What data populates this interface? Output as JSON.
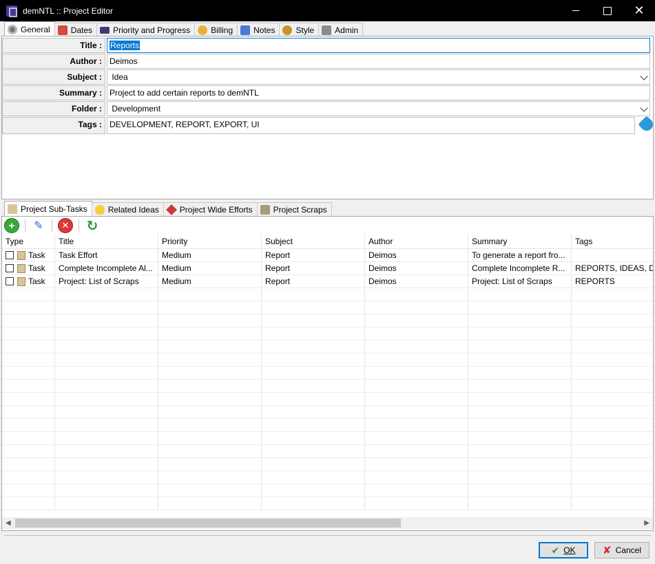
{
  "window": {
    "title": "demNTL :: Project Editor"
  },
  "top_tabs": [
    {
      "label": "General",
      "icon": "gear-icon",
      "active": true
    },
    {
      "label": "Dates",
      "icon": "calendar-icon"
    },
    {
      "label": "Priority and Progress",
      "icon": "priority-icon"
    },
    {
      "label": "Billing",
      "icon": "billing-icon"
    },
    {
      "label": "Notes",
      "icon": "notes-icon"
    },
    {
      "label": "Style",
      "icon": "palette-icon"
    },
    {
      "label": "Admin",
      "icon": "admin-icon"
    }
  ],
  "fields": {
    "title": {
      "label": "Title :",
      "value": "Reports"
    },
    "author": {
      "label": "Author :",
      "value": "Deimos"
    },
    "subject": {
      "label": "Subject :",
      "value": "Idea"
    },
    "summary": {
      "label": "Summary :",
      "value": "Project to add certain reports to demNTL"
    },
    "folder": {
      "label": "Folder :",
      "value": "Development"
    },
    "tags": {
      "label": "Tags :",
      "value": "DEVELOPMENT, REPORT, EXPORT, UI"
    }
  },
  "bottom_tabs": [
    {
      "label": "Project Sub-Tasks",
      "icon": "subtasks-icon",
      "active": true
    },
    {
      "label": "Related Ideas",
      "icon": "lightbulb-icon"
    },
    {
      "label": "Project Wide Efforts",
      "icon": "diamond-icon"
    },
    {
      "label": "Project Scraps",
      "icon": "scraps-icon"
    }
  ],
  "grid": {
    "headers": [
      "Type",
      "Title",
      "Priority",
      "Subject",
      "Author",
      "Summary",
      "Tags"
    ],
    "rows": [
      {
        "type": "Task",
        "title": "Task Effort",
        "priority": "Medium",
        "subject": "Report",
        "author": "Deimos",
        "summary": "To generate a report fro...",
        "tags": ""
      },
      {
        "type": "Task",
        "title": "Complete Incomplete Al...",
        "priority": "Medium",
        "subject": "Report",
        "author": "Deimos",
        "summary": "Complete Incomplete R...",
        "tags": "REPORTS, IDEAS, DEV"
      },
      {
        "type": "Task",
        "title": "Project: List of Scraps",
        "priority": "Medium",
        "subject": "Report",
        "author": "Deimos",
        "summary": "Project: List of Scraps",
        "tags": "REPORTS"
      }
    ]
  },
  "buttons": {
    "ok": "OK",
    "cancel": "Cancel"
  }
}
